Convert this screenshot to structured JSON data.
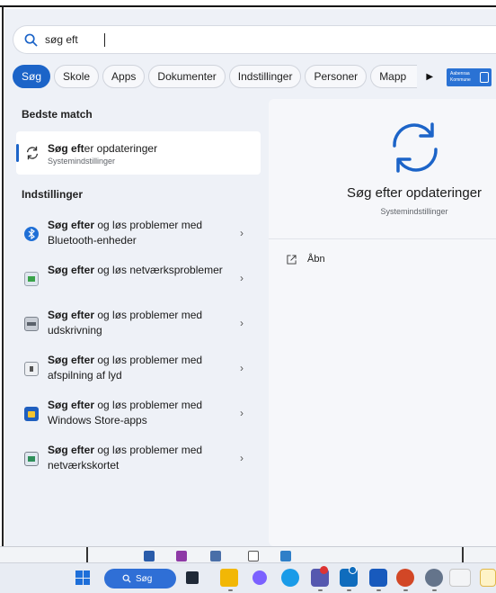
{
  "search": {
    "query": "søg eft",
    "placeholder": ""
  },
  "filters": [
    {
      "label": "Søg",
      "active": true
    },
    {
      "label": "Skole"
    },
    {
      "label": "Apps"
    },
    {
      "label": "Dokumenter"
    },
    {
      "label": "Indstillinger"
    },
    {
      "label": "Personer"
    },
    {
      "label": "Mapp"
    }
  ],
  "brand_badge": {
    "line1": "Aabenraa",
    "line2": "Kommune"
  },
  "best_match": {
    "heading": "Bedste match",
    "title_bold": "Søg eft",
    "title_rest": "er opdateringer",
    "subtitle": "Systemindstillinger"
  },
  "settings": {
    "heading": "Indstillinger",
    "items": [
      {
        "bold": "Søg efter",
        "rest": " og løs problemer med Bluetooth-enheder",
        "icon": "bluetooth-icon",
        "color": "#1f6fd6"
      },
      {
        "bold": "Søg efter",
        "rest": " og løs netværksproblemer",
        "icon": "network-icon",
        "color": "#3aa34a"
      },
      {
        "bold": "Søg efter",
        "rest": " og løs problemer med udskrivning",
        "icon": "printer-icon",
        "color": "#6b7280"
      },
      {
        "bold": "Søg efter",
        "rest": " og løs problemer med afspilning af lyd",
        "icon": "speaker-icon",
        "color": "#9aa0a8"
      },
      {
        "bold": "Søg efter",
        "rest": " og løs problemer med Windows Store-apps",
        "icon": "store-icon",
        "color": "#1f5fbf"
      },
      {
        "bold": "Søg efter",
        "rest": " og løs problemer med netværkskortet",
        "icon": "network-adapter-icon",
        "color": "#2f8f5a"
      }
    ]
  },
  "preview": {
    "title": "Søg efter opdateringer",
    "subtitle": "Systemindstillinger",
    "open_label": "Åbn"
  },
  "taskbar": {
    "search_label": "Søg"
  },
  "colors": {
    "accent": "#1c64c8",
    "panel": "#eef1f7",
    "taskbar": "#e8ecf3"
  }
}
